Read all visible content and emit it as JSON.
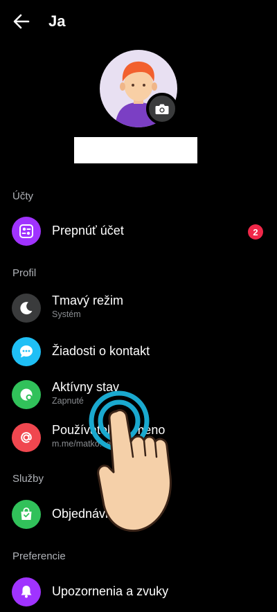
{
  "header": {
    "title": "Ja",
    "back_icon": "arrow-left-icon"
  },
  "profile": {
    "camera_icon": "camera-icon"
  },
  "sections": {
    "accounts": "Účty",
    "profile": "Profil",
    "services": "Služby",
    "preferences": "Preferencie"
  },
  "items": {
    "switch_account": {
      "label": "Prepnúť účet",
      "badge": "2",
      "color": "#a033ff"
    },
    "dark_mode": {
      "label": "Tmavý režim",
      "sub": "Systém",
      "color": "#3a3b3c"
    },
    "contact_requests": {
      "label": "Žiadosti o kontakt",
      "color": "#1fbff5"
    },
    "active_status": {
      "label": "Aktívny stav",
      "sub": "Zapnuté",
      "color": "#31c15a"
    },
    "username": {
      "label": "Používateľské meno",
      "sub": "m.me/matko.sen",
      "color": "#f0474f"
    },
    "orders": {
      "label": "Objednávky",
      "color": "#31c15a"
    },
    "notifications": {
      "label": "Upozornenia a zvuky",
      "color": "#a033ff"
    }
  },
  "colors": {
    "background": "#000000",
    "section_text": "#b0b3b8",
    "badge": "#f02849"
  }
}
